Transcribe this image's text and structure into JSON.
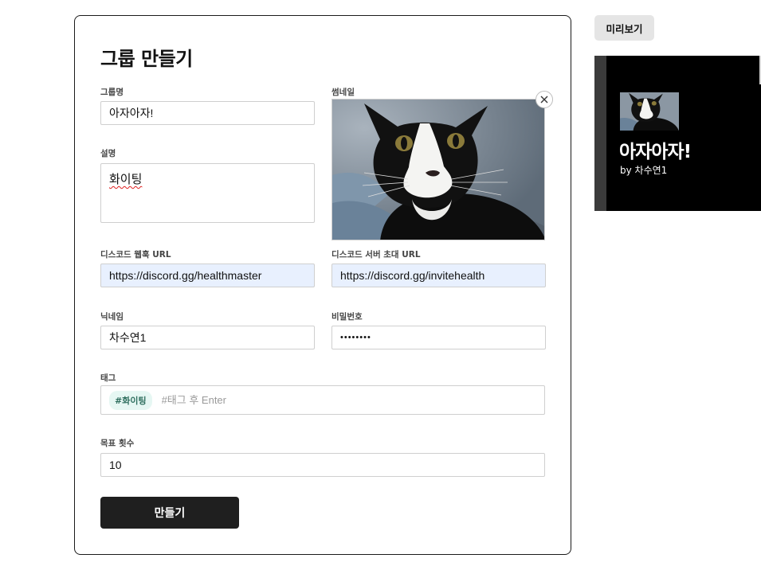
{
  "form": {
    "title": "그룹 만들기",
    "group_name": {
      "label": "그룹명",
      "value": "아자아자!"
    },
    "description": {
      "label": "설명",
      "value": "화이팅"
    },
    "thumbnail": {
      "label": "썸네일"
    },
    "discord_webhook": {
      "label": "디스코드 웹훅 URL",
      "value": "https://discord.gg/healthmaster"
    },
    "discord_invite": {
      "label": "디스코드 서버 초대 URL",
      "value": "https://discord.gg/invitehealth"
    },
    "nickname": {
      "label": "닉네임",
      "value": "차수연1"
    },
    "password": {
      "label": "비밀번호",
      "value": "••••••••"
    },
    "tags": {
      "label": "태그",
      "items": [
        "#화이팅"
      ],
      "placeholder": "#태그 후 Enter"
    },
    "goal": {
      "label": "목표 횟수",
      "value": "10"
    },
    "submit_label": "만들기"
  },
  "preview": {
    "button_label": "미리보기",
    "group_name": "아자아자!",
    "byline": "by 차수연1"
  },
  "colors": {
    "button_dark": "#1f1f1f",
    "autofill_bg": "#e8f0fe",
    "tag_chip_bg": "#e6f7f3",
    "tag_chip_text": "#2f6f5f",
    "preview_bg": "#000000"
  },
  "icons": {
    "thumbnail_remove": "close-icon"
  }
}
